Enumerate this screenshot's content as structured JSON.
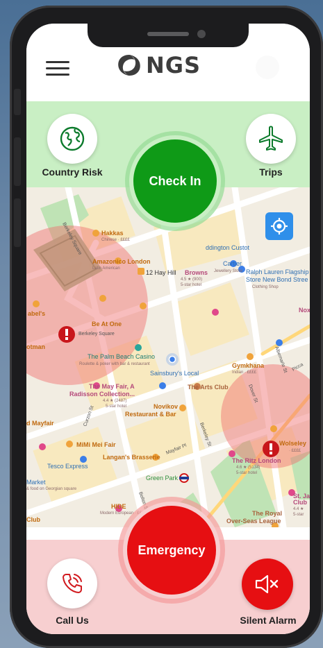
{
  "header": {
    "logo_text": "NGS"
  },
  "actions": {
    "country_risk_label": "Country Risk",
    "trips_label": "Trips",
    "check_in_label": "Check In",
    "emergency_label": "Emergency",
    "call_us_label": "Call Us",
    "silent_alarm_label": "Silent Alarm"
  },
  "map": {
    "places": {
      "hakkasan": "Hakkas",
      "hakkasan_sub": "Chinese · ££££",
      "amazonico": "Amazonico London",
      "amazonico_sub": "Latin American",
      "addington": "ddington Custot",
      "cartier": "Cartier",
      "cartier_sub": "Jewellery Store",
      "ralph_lauren": "Ralph Lauren Flagship",
      "ralph_lauren_2": "Store New Bond Stree",
      "ralph_lauren_sub": "Clothing Shop",
      "isabels": "abel's",
      "be_at_one": "Be At One",
      "berkeley_square": "Berkeley Square",
      "hay_hill": "12 Hay Hill",
      "browns": "Browns",
      "browns_rating": "4.5 ★ (900)",
      "browns_sub": "5-star hotel",
      "palm_beach": "The Palm Beach Casino",
      "palm_beach_sub": "Roulette & poker with bar & restaurant",
      "sainsburys": "Sainsbury's Local",
      "gymkhana": "Gymkhana",
      "gymkhana_sub": "Indian · ££££",
      "arts_club": "The Arts Club",
      "mayfair_a": "The May Fair, A",
      "mayfair_a_2": "Radisson Collection...",
      "mayfair_a_rating": "4.4 ★ (2487)",
      "mayfair_a_sub": "5-star hotel",
      "novikov": "Novikov",
      "novikov_2": "Restaurant & Bar",
      "mayfair": "d Mayfair",
      "mimi": "MiMi Mei Fair",
      "langans": "Langan's Brasserie",
      "tesco": "Tesco Express",
      "green_park": "Green Park",
      "ritz": "The Ritz London",
      "ritz_rating": "4.6 ★ (5134)",
      "ritz_sub": "5-star hotel",
      "wolseley": "Wolseley",
      "wolseley_sub": "· ££££",
      "market": "Market",
      "market_sub": "& food on Georgian square",
      "hide": "HIDE",
      "hide_sub": "Modern European · ££££",
      "st_james": "St. Ja",
      "st_james_2": "Club",
      "st_james_rating": "4.4 ★",
      "st_james_sub": "5-star",
      "royal_overseas": "The Royal",
      "royal_overseas_2": "Over-Seas League",
      "club": "Club",
      "boodman": "otman",
      "nox": "Nox"
    },
    "streets": {
      "berkeley_sq": "Berkeley Square",
      "curzon": "Curzon St",
      "mayfair_pl": "Mayfair Pl",
      "berkeley_st": "Berkeley St",
      "dover": "Dover St",
      "albemarle": "Albemarle St",
      "bolton": "Bolton St",
      "piccadilly": "Picca"
    }
  },
  "colors": {
    "green_band": "#c9efc4",
    "check_in": "#0f9a17",
    "emergency": "#e60f12",
    "pink_band": "#f7cfd0",
    "locate": "#2f8fea"
  },
  "icons": {
    "menu": "hamburger-menu-icon",
    "country_risk": "globe-icon",
    "trips": "airplane-icon",
    "call_us": "phone-call-icon",
    "silent_alarm": "speaker-muted-icon",
    "locate": "crosshair-icon"
  }
}
